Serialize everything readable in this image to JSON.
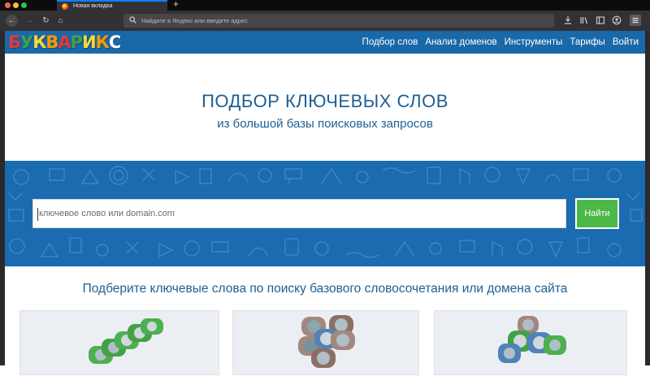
{
  "browser": {
    "tab_title": "Новая вкладка",
    "new_tab_symbol": "+",
    "url_placeholder": "Найдите в Яндекс или введите адрес",
    "icons": {
      "back": "back-arrow-icon",
      "forward": "forward-arrow-icon",
      "reload": "reload-icon",
      "home": "home-icon",
      "search": "search-icon",
      "downloads": "downloads-icon",
      "library": "library-icon",
      "sidebar": "sidebar-icon",
      "account": "account-icon",
      "menu": "hamburger-menu-icon"
    }
  },
  "site": {
    "logo_letters": [
      "Б",
      "У",
      "К",
      "В",
      "А",
      "Р",
      "И",
      "К",
      "С"
    ],
    "logo_colors": [
      "#e53935",
      "#43a047",
      "#fdd835",
      "#ff9800",
      "#e53935",
      "#43a047",
      "#fdd835",
      "#ff9800",
      "#ffffff"
    ],
    "nav": [
      "Подбор слов",
      "Анализ доменов",
      "Инструменты",
      "Тарифы",
      "Войти"
    ],
    "hero_title": "ПОДБОР КЛЮЧЕВЫХ СЛОВ",
    "hero_subtitle": "из большой базы поисковых запросов",
    "search_placeholder": "ключевое слово или domain.com",
    "search_button": "Найти",
    "lower_title": "Подберите ключевые слова по поиску базового словосочетания или домена сайта"
  },
  "colors": {
    "header_blue": "#1968a7",
    "band_blue": "#1a6bb0",
    "text_blue": "#1d5f93",
    "button_green": "#4cb848"
  }
}
